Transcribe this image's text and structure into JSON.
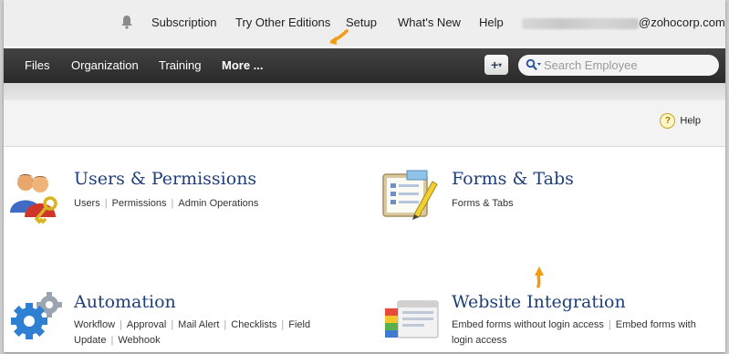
{
  "topbar": {
    "links": [
      "Subscription",
      "Try Other Editions",
      "Setup",
      "What's New",
      "Help"
    ],
    "email_domain": "@zohocorp.com"
  },
  "nav": {
    "items": [
      "Files",
      "Organization",
      "Training",
      "More ..."
    ],
    "add_label": "+",
    "search_placeholder": "Search Employee"
  },
  "help_label": "Help",
  "sections": {
    "users": {
      "title": "Users & Permissions",
      "links": [
        "Users",
        "Permissions",
        "Admin Operations"
      ]
    },
    "forms": {
      "title": "Forms & Tabs",
      "links": [
        "Forms & Tabs"
      ]
    },
    "automation": {
      "title": "Automation",
      "links": [
        "Workflow",
        "Approval",
        "Mail Alert",
        "Checklists",
        "Field Update",
        "Webhook"
      ]
    },
    "website": {
      "title": "Website Integration",
      "links": [
        "Embed forms without login access",
        "Embed forms with login access"
      ]
    }
  },
  "colors": {
    "accent_arrow": "#f39c12",
    "title_blue": "#1f3f78",
    "nav_bg": "#333333"
  }
}
